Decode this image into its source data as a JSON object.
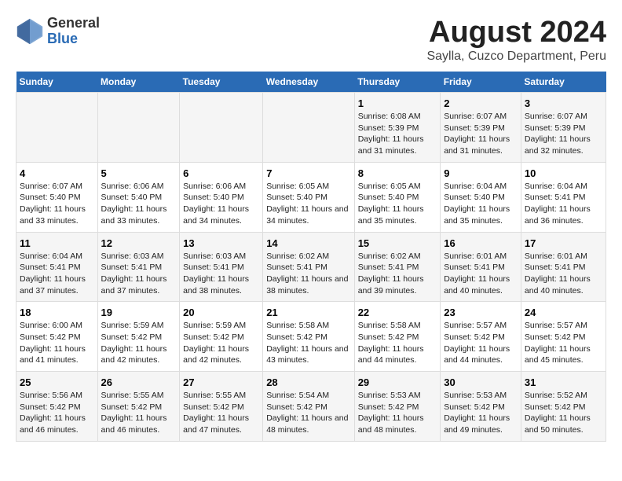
{
  "header": {
    "logo_general": "General",
    "logo_blue": "Blue",
    "main_title": "August 2024",
    "subtitle": "Saylla, Cuzco Department, Peru"
  },
  "days_of_week": [
    "Sunday",
    "Monday",
    "Tuesday",
    "Wednesday",
    "Thursday",
    "Friday",
    "Saturday"
  ],
  "weeks": [
    [
      {
        "day": "",
        "info": ""
      },
      {
        "day": "",
        "info": ""
      },
      {
        "day": "",
        "info": ""
      },
      {
        "day": "",
        "info": ""
      },
      {
        "day": "1",
        "sunrise": "Sunrise: 6:08 AM",
        "sunset": "Sunset: 5:39 PM",
        "daylight": "Daylight: 11 hours and 31 minutes."
      },
      {
        "day": "2",
        "sunrise": "Sunrise: 6:07 AM",
        "sunset": "Sunset: 5:39 PM",
        "daylight": "Daylight: 11 hours and 31 minutes."
      },
      {
        "day": "3",
        "sunrise": "Sunrise: 6:07 AM",
        "sunset": "Sunset: 5:39 PM",
        "daylight": "Daylight: 11 hours and 32 minutes."
      }
    ],
    [
      {
        "day": "4",
        "sunrise": "Sunrise: 6:07 AM",
        "sunset": "Sunset: 5:40 PM",
        "daylight": "Daylight: 11 hours and 33 minutes."
      },
      {
        "day": "5",
        "sunrise": "Sunrise: 6:06 AM",
        "sunset": "Sunset: 5:40 PM",
        "daylight": "Daylight: 11 hours and 33 minutes."
      },
      {
        "day": "6",
        "sunrise": "Sunrise: 6:06 AM",
        "sunset": "Sunset: 5:40 PM",
        "daylight": "Daylight: 11 hours and 34 minutes."
      },
      {
        "day": "7",
        "sunrise": "Sunrise: 6:05 AM",
        "sunset": "Sunset: 5:40 PM",
        "daylight": "Daylight: 11 hours and 34 minutes."
      },
      {
        "day": "8",
        "sunrise": "Sunrise: 6:05 AM",
        "sunset": "Sunset: 5:40 PM",
        "daylight": "Daylight: 11 hours and 35 minutes."
      },
      {
        "day": "9",
        "sunrise": "Sunrise: 6:04 AM",
        "sunset": "Sunset: 5:40 PM",
        "daylight": "Daylight: 11 hours and 35 minutes."
      },
      {
        "day": "10",
        "sunrise": "Sunrise: 6:04 AM",
        "sunset": "Sunset: 5:41 PM",
        "daylight": "Daylight: 11 hours and 36 minutes."
      }
    ],
    [
      {
        "day": "11",
        "sunrise": "Sunrise: 6:04 AM",
        "sunset": "Sunset: 5:41 PM",
        "daylight": "Daylight: 11 hours and 37 minutes."
      },
      {
        "day": "12",
        "sunrise": "Sunrise: 6:03 AM",
        "sunset": "Sunset: 5:41 PM",
        "daylight": "Daylight: 11 hours and 37 minutes."
      },
      {
        "day": "13",
        "sunrise": "Sunrise: 6:03 AM",
        "sunset": "Sunset: 5:41 PM",
        "daylight": "Daylight: 11 hours and 38 minutes."
      },
      {
        "day": "14",
        "sunrise": "Sunrise: 6:02 AM",
        "sunset": "Sunset: 5:41 PM",
        "daylight": "Daylight: 11 hours and 38 minutes."
      },
      {
        "day": "15",
        "sunrise": "Sunrise: 6:02 AM",
        "sunset": "Sunset: 5:41 PM",
        "daylight": "Daylight: 11 hours and 39 minutes."
      },
      {
        "day": "16",
        "sunrise": "Sunrise: 6:01 AM",
        "sunset": "Sunset: 5:41 PM",
        "daylight": "Daylight: 11 hours and 40 minutes."
      },
      {
        "day": "17",
        "sunrise": "Sunrise: 6:01 AM",
        "sunset": "Sunset: 5:41 PM",
        "daylight": "Daylight: 11 hours and 40 minutes."
      }
    ],
    [
      {
        "day": "18",
        "sunrise": "Sunrise: 6:00 AM",
        "sunset": "Sunset: 5:42 PM",
        "daylight": "Daylight: 11 hours and 41 minutes."
      },
      {
        "day": "19",
        "sunrise": "Sunrise: 5:59 AM",
        "sunset": "Sunset: 5:42 PM",
        "daylight": "Daylight: 11 hours and 42 minutes."
      },
      {
        "day": "20",
        "sunrise": "Sunrise: 5:59 AM",
        "sunset": "Sunset: 5:42 PM",
        "daylight": "Daylight: 11 hours and 42 minutes."
      },
      {
        "day": "21",
        "sunrise": "Sunrise: 5:58 AM",
        "sunset": "Sunset: 5:42 PM",
        "daylight": "Daylight: 11 hours and 43 minutes."
      },
      {
        "day": "22",
        "sunrise": "Sunrise: 5:58 AM",
        "sunset": "Sunset: 5:42 PM",
        "daylight": "Daylight: 11 hours and 44 minutes."
      },
      {
        "day": "23",
        "sunrise": "Sunrise: 5:57 AM",
        "sunset": "Sunset: 5:42 PM",
        "daylight": "Daylight: 11 hours and 44 minutes."
      },
      {
        "day": "24",
        "sunrise": "Sunrise: 5:57 AM",
        "sunset": "Sunset: 5:42 PM",
        "daylight": "Daylight: 11 hours and 45 minutes."
      }
    ],
    [
      {
        "day": "25",
        "sunrise": "Sunrise: 5:56 AM",
        "sunset": "Sunset: 5:42 PM",
        "daylight": "Daylight: 11 hours and 46 minutes."
      },
      {
        "day": "26",
        "sunrise": "Sunrise: 5:55 AM",
        "sunset": "Sunset: 5:42 PM",
        "daylight": "Daylight: 11 hours and 46 minutes."
      },
      {
        "day": "27",
        "sunrise": "Sunrise: 5:55 AM",
        "sunset": "Sunset: 5:42 PM",
        "daylight": "Daylight: 11 hours and 47 minutes."
      },
      {
        "day": "28",
        "sunrise": "Sunrise: 5:54 AM",
        "sunset": "Sunset: 5:42 PM",
        "daylight": "Daylight: 11 hours and 48 minutes."
      },
      {
        "day": "29",
        "sunrise": "Sunrise: 5:53 AM",
        "sunset": "Sunset: 5:42 PM",
        "daylight": "Daylight: 11 hours and 48 minutes."
      },
      {
        "day": "30",
        "sunrise": "Sunrise: 5:53 AM",
        "sunset": "Sunset: 5:42 PM",
        "daylight": "Daylight: 11 hours and 49 minutes."
      },
      {
        "day": "31",
        "sunrise": "Sunrise: 5:52 AM",
        "sunset": "Sunset: 5:42 PM",
        "daylight": "Daylight: 11 hours and 50 minutes."
      }
    ]
  ]
}
